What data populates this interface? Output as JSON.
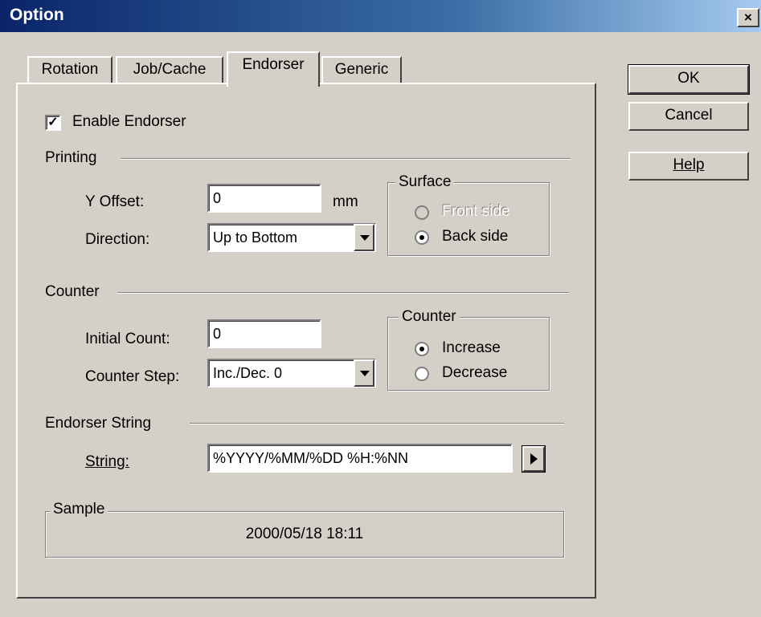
{
  "window": {
    "title": "Option",
    "close_glyph": "×"
  },
  "tabs": [
    {
      "label": "Rotation",
      "active": false
    },
    {
      "label": "Job/Cache",
      "active": false
    },
    {
      "label": "Endorser",
      "active": true
    },
    {
      "label": "Generic",
      "active": false
    }
  ],
  "buttons": {
    "ok": "OK",
    "cancel": "Cancel",
    "help": "Help"
  },
  "enable": {
    "label": "Enable Endorser",
    "checked": true,
    "check_glyph": "✓"
  },
  "printing": {
    "heading": "Printing",
    "y_offset_label": "Y Offset:",
    "y_offset_value": "0",
    "y_offset_unit": "mm",
    "direction_label": "Direction:",
    "direction_value": "Up to Bottom",
    "surface": {
      "legend": "Surface",
      "front": "Front side",
      "back": "Back side",
      "selected": "back",
      "front_enabled": false
    }
  },
  "counter": {
    "heading": "Counter",
    "initial_label": "Initial Count:",
    "initial_value": "0",
    "step_label": "Counter Step:",
    "step_value": "Inc./Dec. 0",
    "group": {
      "legend": "Counter",
      "increase": "Increase",
      "decrease": "Decrease",
      "selected": "increase"
    }
  },
  "endorser_string": {
    "heading": "Endorser String",
    "string_label": "String:",
    "string_value": "%YYYY/%MM/%DD %H:%NN"
  },
  "sample": {
    "legend": "Sample",
    "value": "2000/05/18 18:11"
  },
  "icons": {
    "close": "close-icon",
    "dropdown": "chevron-down-icon",
    "insert": "play-arrow-icon"
  }
}
